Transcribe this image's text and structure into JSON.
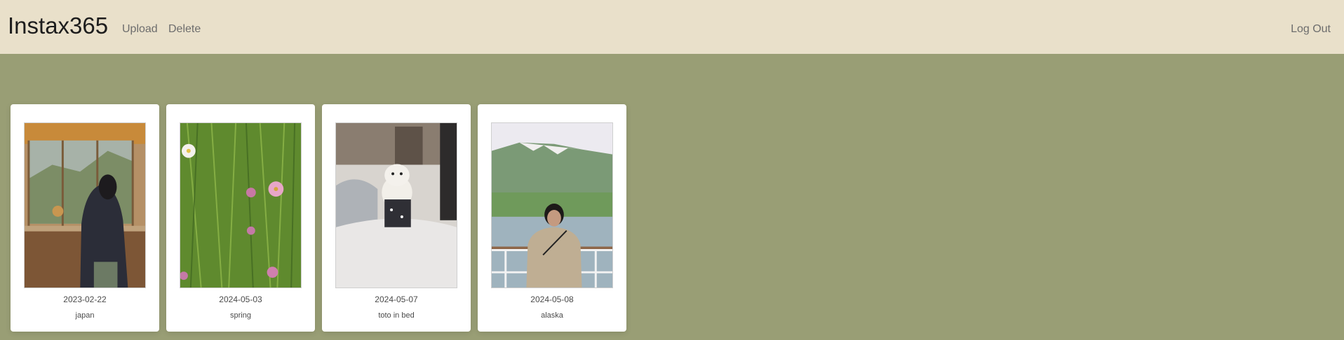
{
  "header": {
    "brand": "Instax365",
    "nav": {
      "upload": "Upload",
      "delete": "Delete",
      "logout": "Log Out"
    }
  },
  "photos": [
    {
      "date": "2023-02-22",
      "caption": "japan"
    },
    {
      "date": "2024-05-03",
      "caption": "spring"
    },
    {
      "date": "2024-05-07",
      "caption": "toto in bed"
    },
    {
      "date": "2024-05-08",
      "caption": "alaska"
    }
  ],
  "colors": {
    "page_background": "#999e75",
    "navbar_background": "#e9e0ca",
    "card_background": "#ffffff"
  }
}
